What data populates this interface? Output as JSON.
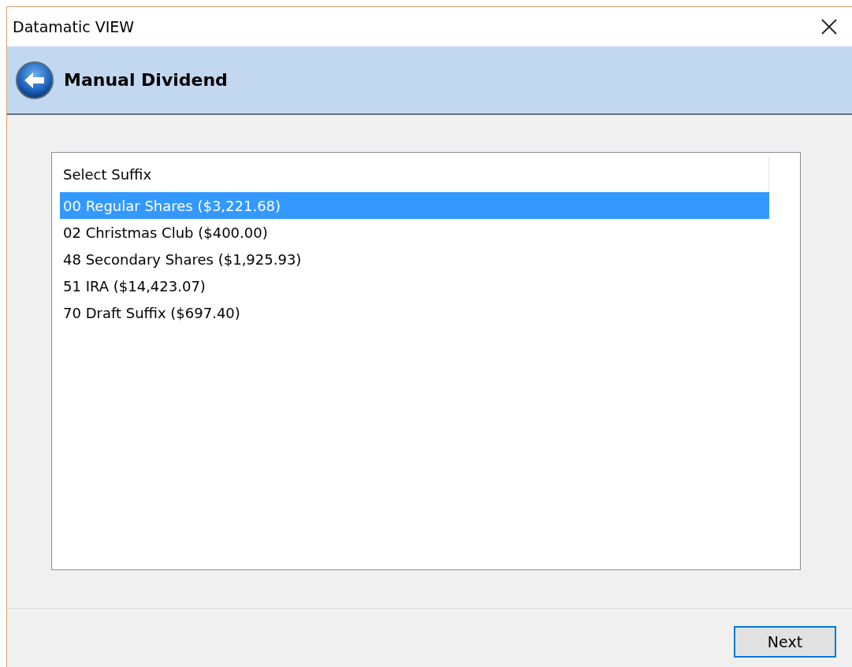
{
  "window": {
    "title": "Datamatic VIEW"
  },
  "header": {
    "title": "Manual Dividend"
  },
  "list": {
    "column_header": "Select Suffix",
    "items": [
      {
        "label": "00 Regular Shares ($3,221.68)",
        "selected": true
      },
      {
        "label": "02 Christmas Club ($400.00)",
        "selected": false
      },
      {
        "label": "48 Secondary Shares ($1,925.93)",
        "selected": false
      },
      {
        "label": "51 IRA ($14,423.07)",
        "selected": false
      },
      {
        "label": "70 Draft Suffix ($697.40)",
        "selected": false
      }
    ]
  },
  "buttons": [
    {
      "label": "Next"
    }
  ]
}
